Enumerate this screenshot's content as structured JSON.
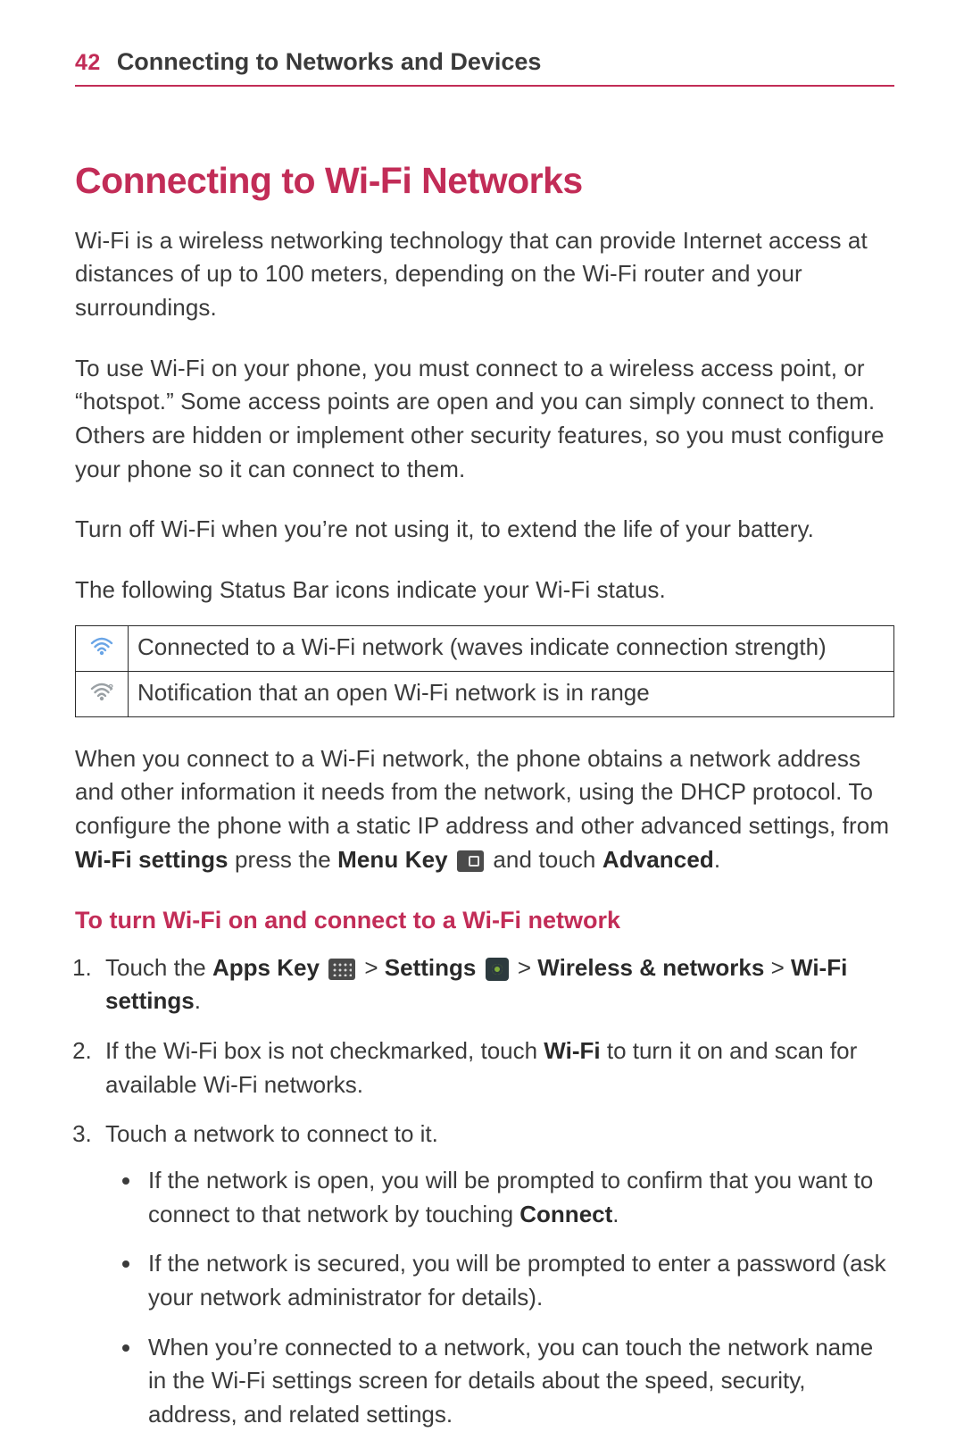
{
  "header": {
    "page_number": "42",
    "running_title": "Connecting to Networks and Devices"
  },
  "section": {
    "title": "Connecting to Wi-Fi Networks",
    "p1": "Wi-Fi is a wireless networking technology that can provide Internet access at distances of up to 100 meters, depending on the Wi-Fi router and your surroundings.",
    "p2": "To use Wi-Fi on your phone, you must connect to a wireless access point, or “hotspot.” Some access points are open and you can simply connect to them. Others are hidden or implement other security features, so you must configure your phone so it can connect to them.",
    "p3": "Turn off Wi-Fi when you’re not using it, to extend the life of your battery.",
    "p4": "The following Status Bar icons indicate your Wi-Fi status."
  },
  "status_table": {
    "row1": "Connected to a Wi-Fi network (waves indicate connection strength)",
    "row2": "Notification that an open Wi-Fi network is in range"
  },
  "after_table": {
    "lead": "When you connect to a Wi-Fi network, the phone obtains a network address and other information it needs from the network, using the DHCP protocol. To configure the phone with a static IP address and other advanced settings, from ",
    "bold1": "Wi-Fi settings",
    "mid1": " press the ",
    "bold2": "Menu Key",
    "mid2": " and touch ",
    "bold3": "Advanced",
    "tail": "."
  },
  "subhead": "To turn Wi-Fi on and connect to a Wi-Fi network",
  "steps": {
    "s1": {
      "lead": "Touch the ",
      "apps": "Apps Key",
      "gt1": " > ",
      "settings": "Settings",
      "gt2": " > ",
      "wn": "Wireless & networks",
      "gt3": " > ",
      "wifi": "Wi-Fi settings",
      "tail": "."
    },
    "s2": {
      "lead": "If the Wi-Fi box is not checkmarked, touch ",
      "wifi": "Wi-Fi",
      "tail": " to turn it on and scan for available Wi-Fi networks."
    },
    "s3": {
      "text": "Touch a network to connect to it.",
      "b1": {
        "lead": "If the network is open, you will be prompted to confirm that you want to connect to that network by touching ",
        "connect": "Connect",
        "tail": "."
      },
      "b2": "If the network is secured, you will be prompted to enter a password (ask your network administrator for details).",
      "b3": "When you’re connected to a network, you can touch the network name in the Wi-Fi settings screen for details about the speed, security, address, and related settings."
    }
  }
}
